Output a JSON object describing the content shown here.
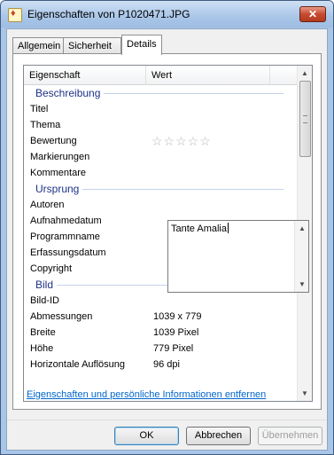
{
  "window": {
    "title": "Eigenschaften von P1020471.JPG",
    "close_label": "✕"
  },
  "tabs": [
    {
      "label": "Allgemein"
    },
    {
      "label": "Sicherheit"
    },
    {
      "label": "Details"
    }
  ],
  "columns": {
    "property": "Eigenschaft",
    "value": "Wert"
  },
  "groups": {
    "beschreibung": "Beschreibung",
    "ursprung": "Ursprung",
    "bild": "Bild"
  },
  "rows": {
    "titel": "Titel",
    "thema": "Thema",
    "bewertung": "Bewertung",
    "bewertung_stars": "☆☆☆☆☆",
    "markierungen": "Markierungen",
    "kommentare": "Kommentare",
    "autoren": "Autoren",
    "aufnahmedatum": "Aufnahmedatum",
    "programmname": "Programmname",
    "erfassungsdatum": "Erfassungsdatum",
    "copyright": "Copyright",
    "bild_id": "Bild-ID",
    "abmessungen": "Abmessungen",
    "abmessungen_value": "1039 x 779",
    "breite": "Breite",
    "breite_value": "1039 Pixel",
    "hoehe": "Höhe",
    "hoehe_value": "779 Pixel",
    "horizontale": "Horizontale Auflösung",
    "horizontale_value": "96 dpi"
  },
  "rating": {
    "stars_filled": 0,
    "stars_total": 5
  },
  "comment": {
    "value": "Tante Amalia"
  },
  "remove_link": "Eigenschaften und persönliche Informationen entfernen",
  "buttons": {
    "ok": "OK",
    "cancel": "Abbrechen",
    "apply": "Übernehmen"
  },
  "icons": {
    "app": "image-file-icon",
    "close": "close-icon",
    "scroll_up": "scroll-up-arrow-icon",
    "scroll_down": "scroll-down-arrow-icon"
  }
}
